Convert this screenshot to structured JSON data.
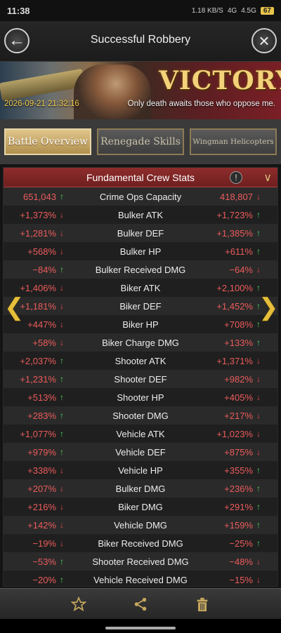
{
  "status_bar": {
    "time": "11:38",
    "net": "1.18 KB/S",
    "signal1": "4G",
    "signal2": "4.5G",
    "battery": "67"
  },
  "header": {
    "title": "Successful Robbery",
    "back_icon": "back-arrow-icon",
    "close_icon": "close-icon"
  },
  "banner": {
    "victory_text": "VICTORY",
    "datetime": "2026-09-21 21:32:16",
    "tagline": "Only death awaits those who oppose me."
  },
  "tabs": [
    {
      "label": "Battle Overview",
      "active": true
    },
    {
      "label": "Renegade Skills",
      "active": false
    },
    {
      "label": "Wingman Helicopters",
      "active": false
    }
  ],
  "panel": {
    "title": "Fundamental Crew Stats"
  },
  "stats": [
    {
      "name": "Crime Ops Capacity",
      "left": "651,043",
      "left_dir": "up",
      "right": "418,807",
      "right_dir": "down"
    },
    {
      "name": "Bulker ATK",
      "left": "+1,373%",
      "left_dir": "down",
      "right": "+1,723%",
      "right_dir": "up"
    },
    {
      "name": "Bulker DEF",
      "left": "+1,281%",
      "left_dir": "down",
      "right": "+1,385%",
      "right_dir": "up"
    },
    {
      "name": "Bulker HP",
      "left": "+568%",
      "left_dir": "down",
      "right": "+611%",
      "right_dir": "up"
    },
    {
      "name": "Bulker Received DMG",
      "left": "−84%",
      "left_dir": "up",
      "right": "−64%",
      "right_dir": "down"
    },
    {
      "name": "Biker ATK",
      "left": "+1,406%",
      "left_dir": "down",
      "right": "+2,100%",
      "right_dir": "up"
    },
    {
      "name": "Biker DEF",
      "left": "+1,181%",
      "left_dir": "down",
      "right": "+1,452%",
      "right_dir": "up"
    },
    {
      "name": "Biker HP",
      "left": "+447%",
      "left_dir": "down",
      "right": "+708%",
      "right_dir": "up"
    },
    {
      "name": "Biker Charge DMG",
      "left": "+58%",
      "left_dir": "down",
      "right": "+133%",
      "right_dir": "up"
    },
    {
      "name": "Shooter ATK",
      "left": "+2,037%",
      "left_dir": "up",
      "right": "+1,371%",
      "right_dir": "down"
    },
    {
      "name": "Shooter DEF",
      "left": "+1,231%",
      "left_dir": "up",
      "right": "+982%",
      "right_dir": "down"
    },
    {
      "name": "Shooter HP",
      "left": "+513%",
      "left_dir": "up",
      "right": "+405%",
      "right_dir": "down"
    },
    {
      "name": "Shooter DMG",
      "left": "+283%",
      "left_dir": "up",
      "right": "+217%",
      "right_dir": "down"
    },
    {
      "name": "Vehicle ATK",
      "left": "+1,077%",
      "left_dir": "up",
      "right": "+1,023%",
      "right_dir": "down"
    },
    {
      "name": "Vehicle DEF",
      "left": "+979%",
      "left_dir": "up",
      "right": "+875%",
      "right_dir": "down"
    },
    {
      "name": "Vehicle HP",
      "left": "+338%",
      "left_dir": "down",
      "right": "+355%",
      "right_dir": "up"
    },
    {
      "name": "Bulker DMG",
      "left": "+207%",
      "left_dir": "down",
      "right": "+236%",
      "right_dir": "up"
    },
    {
      "name": "Biker DMG",
      "left": "+216%",
      "left_dir": "down",
      "right": "+291%",
      "right_dir": "up"
    },
    {
      "name": "Vehicle DMG",
      "left": "+142%",
      "left_dir": "down",
      "right": "+159%",
      "right_dir": "up"
    },
    {
      "name": "Biker Received DMG",
      "left": "−19%",
      "left_dir": "down",
      "right": "−25%",
      "right_dir": "up"
    },
    {
      "name": "Shooter Received DMG",
      "left": "−53%",
      "left_dir": "up",
      "right": "−48%",
      "right_dir": "down"
    },
    {
      "name": "Vehicle Received DMG",
      "left": "−20%",
      "left_dir": "up",
      "right": "−15%",
      "right_dir": "down"
    }
  ],
  "nav": {
    "prev_icon": "chevron-left-icon",
    "next_icon": "chevron-right-icon"
  },
  "bottom_bar": {
    "favorite_icon": "star-icon",
    "share_icon": "share-icon",
    "delete_icon": "trash-icon"
  },
  "colors": {
    "accent_red": "#8e2c2c",
    "gold": "#e6be3a",
    "up_green": "#4ed35e",
    "down_red": "#e84848",
    "value_red": "#ec5b5b"
  }
}
